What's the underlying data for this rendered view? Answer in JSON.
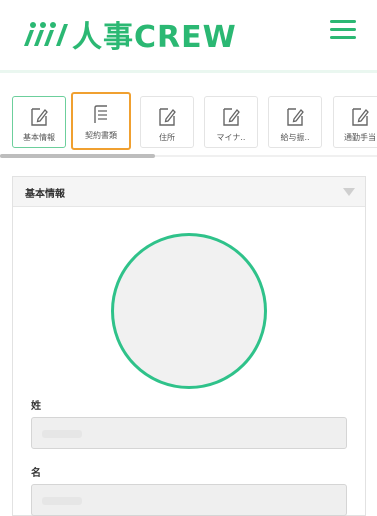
{
  "header": {
    "brand_text": "人事CREW",
    "menu_icon": "hamburger-icon",
    "accent_color": "#2bb873"
  },
  "tabs": [
    {
      "label": "基本情報",
      "icon": "edit-icon",
      "state": "active"
    },
    {
      "label": "契約書類",
      "icon": "document-icon",
      "state": "focused"
    },
    {
      "label": "住所",
      "icon": "edit-icon",
      "state": "normal"
    },
    {
      "label": "マイナ..",
      "icon": "edit-icon",
      "state": "normal"
    },
    {
      "label": "給与振..",
      "icon": "edit-icon",
      "state": "normal"
    },
    {
      "label": "通勤手当",
      "icon": "edit-icon",
      "state": "normal"
    }
  ],
  "section": {
    "title": "基本情報",
    "fields": [
      {
        "label": "姓",
        "value": ""
      },
      {
        "label": "名",
        "value": ""
      }
    ]
  }
}
